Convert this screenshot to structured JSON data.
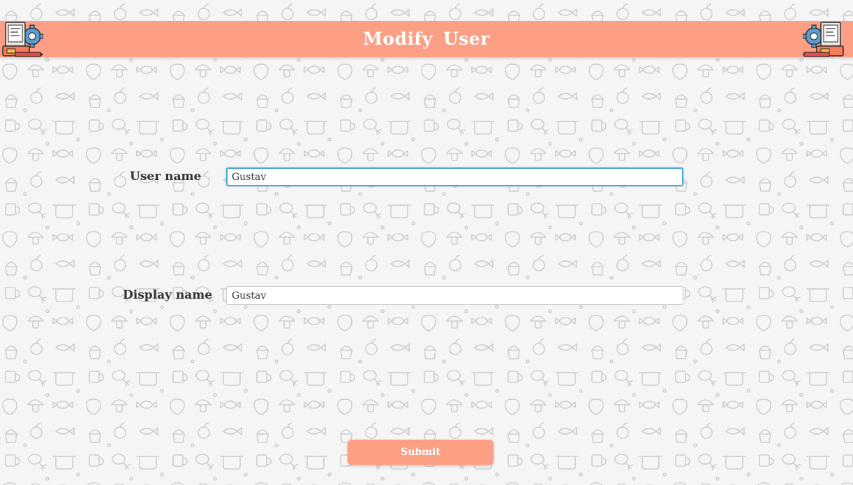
{
  "header": {
    "title": "Modify  User",
    "logo_left_icon": "chef-computer-settings-icon",
    "logo_right_icon": "chef-computer-settings-icon",
    "background_color": "#fc9f85"
  },
  "background": {
    "pattern_icon": "food-doodle-pattern",
    "color": "#f4f4f4"
  },
  "form": {
    "user_name": {
      "label": "User name",
      "value": "Gustav",
      "focused": true
    },
    "display_name": {
      "label": "Display name",
      "value": "Gustav",
      "focused": false
    },
    "submit_label": "Submit",
    "accent_color": "#fc9f85",
    "focus_color": "#4aa9d3"
  }
}
